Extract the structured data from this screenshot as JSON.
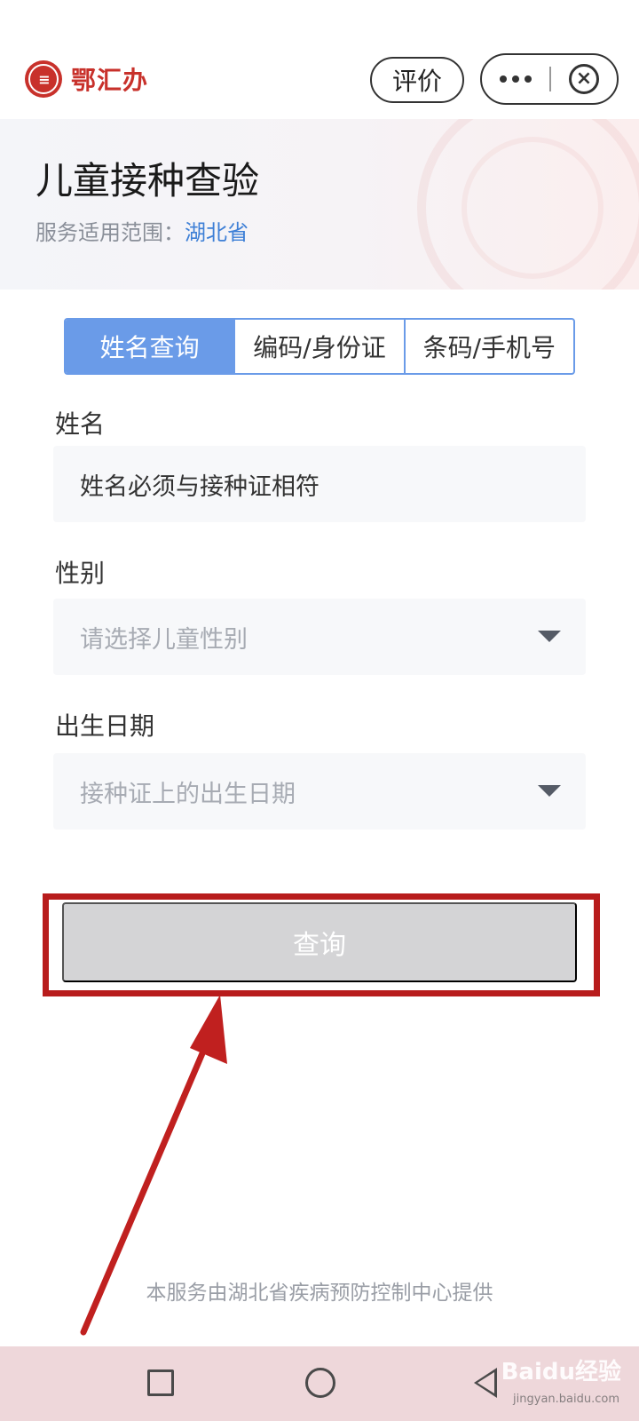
{
  "header": {
    "brand_name": "鄂汇办",
    "rate_label": "评价"
  },
  "banner": {
    "title": "儿童接种查验",
    "scope_label": "服务适用范围：",
    "scope_value": "湖北省"
  },
  "tabs": [
    {
      "label": "姓名查询",
      "active": true
    },
    {
      "label": "编码/身份证",
      "active": false
    },
    {
      "label": "条码/手机号",
      "active": false
    }
  ],
  "form": {
    "name": {
      "label": "姓名",
      "value": "姓名必须与接种证相符"
    },
    "gender": {
      "label": "性别",
      "placeholder": "请选择儿童性别"
    },
    "birthdate": {
      "label": "出生日期",
      "placeholder": "接种证上的出生日期"
    }
  },
  "submit": {
    "label": "查询"
  },
  "footer": {
    "note": "本服务由湖北省疾病预防控制中心提供"
  },
  "watermark": {
    "brand": "Baidu经验",
    "url": "jingyan.baidu.com"
  },
  "colors": {
    "accent": "#6a9be8",
    "brand": "#c8312b",
    "highlight": "#b81c1c",
    "disabled_button": "#d4d4d6"
  }
}
